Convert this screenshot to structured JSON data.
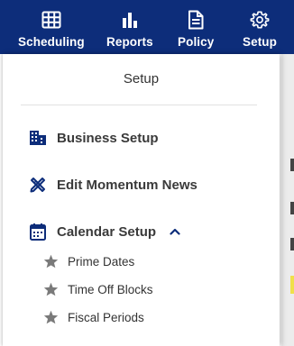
{
  "nav": {
    "items": [
      {
        "label": "Scheduling",
        "icon": "grid-icon"
      },
      {
        "label": "Reports",
        "icon": "bar-chart-icon"
      },
      {
        "label": "Policy",
        "icon": "document-icon"
      },
      {
        "label": "Setup",
        "icon": "gear-icon"
      }
    ],
    "background_color": "#0d2d7a"
  },
  "panel": {
    "title": "Setup",
    "items": [
      {
        "label": "Business Setup",
        "icon": "building-icon"
      },
      {
        "label": "Edit Momentum News",
        "icon": "pencil-ruler-icon"
      },
      {
        "label": "Calendar Setup",
        "icon": "calendar-icon",
        "expanded": true
      }
    ],
    "calendar_sub_items": [
      {
        "label": "Prime Dates",
        "icon": "star-icon"
      },
      {
        "label": "Time Off Blocks",
        "icon": "star-icon"
      },
      {
        "label": "Fiscal Periods",
        "icon": "star-icon"
      }
    ],
    "icon_color": "#0d2d7a",
    "sub_icon_color": "#7a7a7a"
  }
}
